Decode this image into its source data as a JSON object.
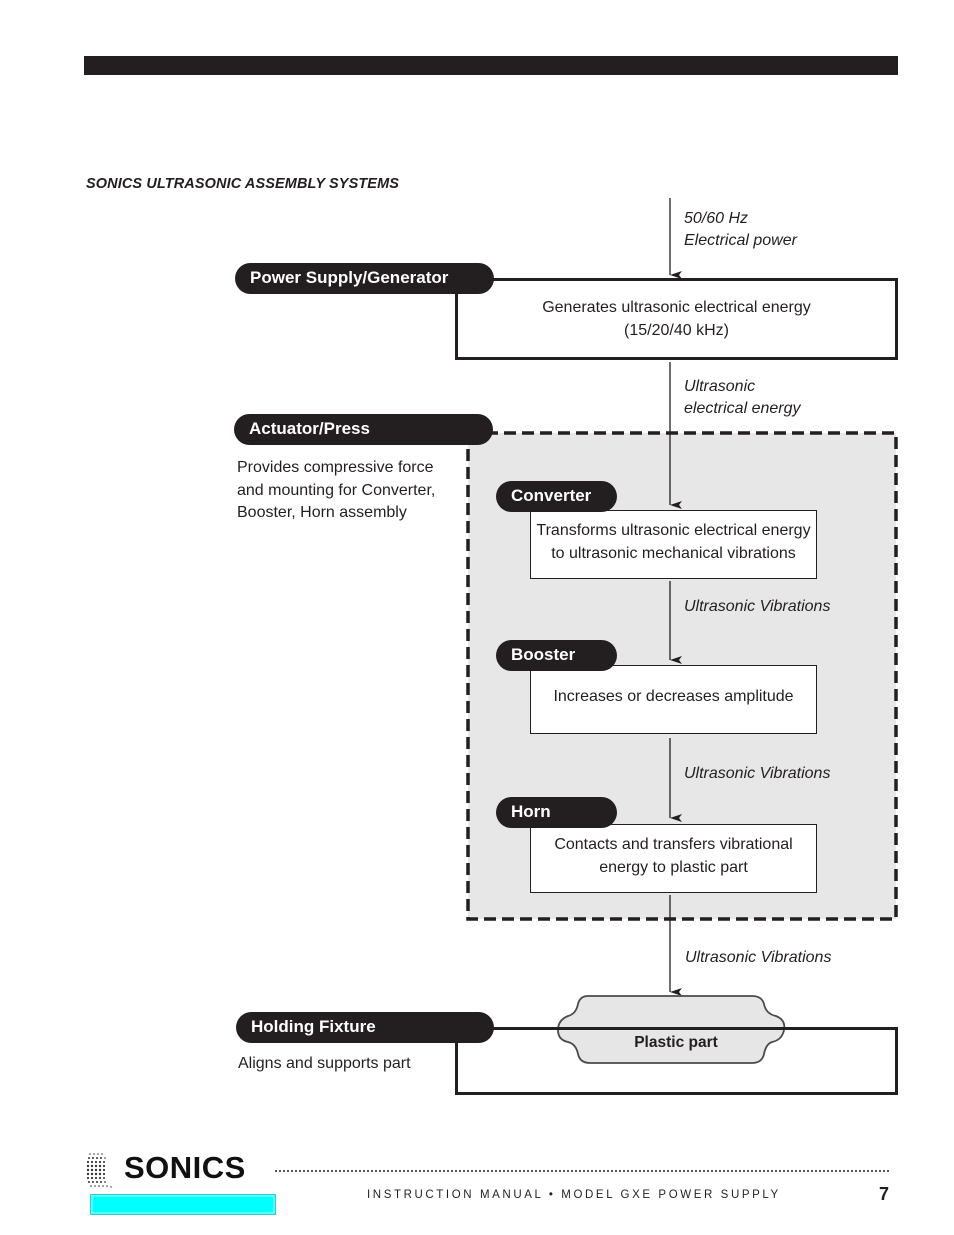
{
  "page": {
    "section_title": "SONICS ULTRASONIC ASSEMBLY SYSTEMS",
    "footer": {
      "brand": "SONICS",
      "manual_title": "INSTRUCTION MANUAL • MODEL GXE POWER SUPPLY",
      "page_number": "7"
    }
  },
  "diagram": {
    "input_label": {
      "line1": "50/60 Hz",
      "line2": "Electrical power"
    },
    "power_supply": {
      "title": "Power Supply/Generator",
      "line1": "Generates ultrasonic electrical energy",
      "line2": "(15/20/40 kHz)"
    },
    "ps_to_converter_label": {
      "line1": "Ultrasonic",
      "line2": "electrical energy"
    },
    "actuator": {
      "title": "Actuator/Press",
      "desc_line1": "Provides compressive force",
      "desc_line2": "and mounting for Converter,",
      "desc_line3": "Booster, Horn assembly"
    },
    "converter": {
      "title": "Converter",
      "line1": "Transforms ultrasonic electrical energy",
      "line2": "to ultrasonic mechanical vibrations"
    },
    "converter_to_booster_label": "Ultrasonic Vibrations",
    "booster": {
      "title": "Booster",
      "line1": "Increases or decreases amplitude"
    },
    "booster_to_horn_label": "Ultrasonic Vibrations",
    "horn": {
      "title": "Horn",
      "line1": "Contacts and transfers vibrational",
      "line2": "energy to plastic part"
    },
    "horn_to_part_label": "Ultrasonic Vibrations",
    "holding_fixture": {
      "title": "Holding Fixture",
      "desc": "Aligns and supports part"
    },
    "plastic_part": {
      "label": "Plastic part"
    },
    "colors": {
      "ink": "#231f20",
      "panel_gray": "#e7e7e7",
      "footer_accent": "#00ffff"
    }
  }
}
